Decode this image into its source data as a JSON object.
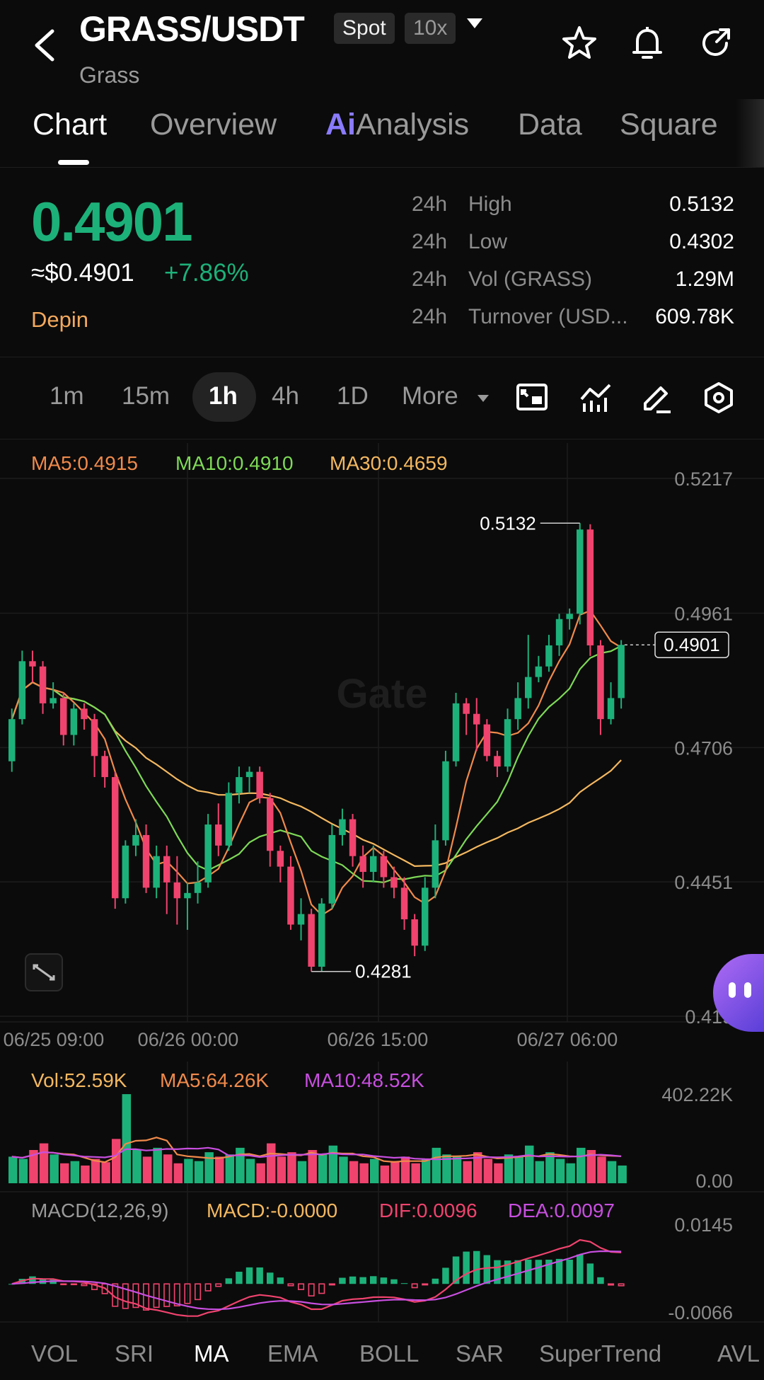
{
  "header": {
    "pair": "GRASS/USDT",
    "market_type": "Spot",
    "leverage": "10x",
    "subtitle": "Grass"
  },
  "tabs": [
    {
      "label": "Chart",
      "active": true
    },
    {
      "label": "Overview"
    },
    {
      "ai_prefix": "Ai",
      "label": "Analysis"
    },
    {
      "label": "Data"
    },
    {
      "label": "Square"
    }
  ],
  "ticker": {
    "price": "0.4901",
    "usd_price": "≈$0.4901",
    "change": "+7.86%",
    "tag": "Depin",
    "stats": [
      {
        "period": "24h",
        "label": "High",
        "value": "0.5132"
      },
      {
        "period": "24h",
        "label": "Low",
        "value": "0.4302"
      },
      {
        "period": "24h",
        "label": "Vol (GRASS)",
        "value": "1.29M"
      },
      {
        "period": "24h",
        "label": "Turnover (USD...",
        "value": "609.78K"
      }
    ]
  },
  "timeframes": [
    "1m",
    "15m",
    "1h",
    "4h",
    "1D",
    "More"
  ],
  "active_timeframe": "1h",
  "chart_data": {
    "type": "candlestick",
    "ma_legend": [
      {
        "text": "MA5:0.4915",
        "color": "#f08a4b"
      },
      {
        "text": "MA10:0.4910",
        "color": "#7ed957"
      },
      {
        "text": "MA30:0.4659",
        "color": "#f4b860"
      }
    ],
    "y_ticks": [
      "0.5217",
      "0.4961",
      "0.4706",
      "0.4451",
      "0.419"
    ],
    "y_tick_values": [
      0.5217,
      0.4961,
      0.4706,
      0.4451,
      0.4196
    ],
    "x_ticks": [
      "06/25 09:00",
      "06/26 00:00",
      "06/26 15:00",
      "06/27 06:00"
    ],
    "high_label": "0.5132",
    "low_label": "0.4281",
    "last_price_label": "0.4901",
    "watermark": "Gate",
    "candles": [
      [
        0.468,
        0.476,
        0.466,
        0.478
      ],
      [
        0.476,
        0.487,
        0.475,
        0.489
      ],
      [
        0.487,
        0.486,
        0.483,
        0.489
      ],
      [
        0.486,
        0.479,
        0.477,
        0.487
      ],
      [
        0.479,
        0.48,
        0.478,
        0.483
      ],
      [
        0.48,
        0.473,
        0.471,
        0.481
      ],
      [
        0.473,
        0.478,
        0.471,
        0.479
      ],
      [
        0.478,
        0.476,
        0.474,
        0.479
      ],
      [
        0.476,
        0.469,
        0.465,
        0.477
      ],
      [
        0.469,
        0.465,
        0.463,
        0.47
      ],
      [
        0.465,
        0.442,
        0.44,
        0.466
      ],
      [
        0.442,
        0.452,
        0.441,
        0.453
      ],
      [
        0.452,
        0.454,
        0.45,
        0.457
      ],
      [
        0.454,
        0.444,
        0.443,
        0.456
      ],
      [
        0.444,
        0.45,
        0.442,
        0.452
      ],
      [
        0.45,
        0.445,
        0.439,
        0.452
      ],
      [
        0.445,
        0.442,
        0.437,
        0.45
      ],
      [
        0.442,
        0.443,
        0.436,
        0.445
      ],
      [
        0.443,
        0.445,
        0.441,
        0.449
      ],
      [
        0.445,
        0.456,
        0.444,
        0.458
      ],
      [
        0.456,
        0.452,
        0.45,
        0.46
      ],
      [
        0.452,
        0.462,
        0.451,
        0.464
      ],
      [
        0.462,
        0.465,
        0.46,
        0.467
      ],
      [
        0.465,
        0.466,
        0.462,
        0.467
      ],
      [
        0.466,
        0.461,
        0.46,
        0.467
      ],
      [
        0.461,
        0.451,
        0.448,
        0.462
      ],
      [
        0.451,
        0.448,
        0.445,
        0.452
      ],
      [
        0.448,
        0.437,
        0.436,
        0.45
      ],
      [
        0.437,
        0.439,
        0.434,
        0.442
      ],
      [
        0.439,
        0.429,
        0.4281,
        0.44
      ],
      [
        0.429,
        0.441,
        0.4281,
        0.442
      ],
      [
        0.441,
        0.454,
        0.44,
        0.456
      ],
      [
        0.454,
        0.457,
        0.452,
        0.459
      ],
      [
        0.457,
        0.45,
        0.448,
        0.458
      ],
      [
        0.45,
        0.447,
        0.444,
        0.452
      ],
      [
        0.447,
        0.45,
        0.445,
        0.452
      ],
      [
        0.45,
        0.446,
        0.444,
        0.451
      ],
      [
        0.446,
        0.444,
        0.442,
        0.448
      ],
      [
        0.444,
        0.438,
        0.436,
        0.446
      ],
      [
        0.438,
        0.433,
        0.431,
        0.439
      ],
      [
        0.433,
        0.444,
        0.432,
        0.446
      ],
      [
        0.444,
        0.453,
        0.442,
        0.456
      ],
      [
        0.453,
        0.468,
        0.452,
        0.47
      ],
      [
        0.468,
        0.479,
        0.467,
        0.481
      ],
      [
        0.479,
        0.477,
        0.473,
        0.48
      ],
      [
        0.477,
        0.475,
        0.47,
        0.48
      ],
      [
        0.475,
        0.469,
        0.468,
        0.476
      ],
      [
        0.469,
        0.467,
        0.465,
        0.47
      ],
      [
        0.467,
        0.476,
        0.466,
        0.478
      ],
      [
        0.476,
        0.48,
        0.474,
        0.483
      ],
      [
        0.48,
        0.484,
        0.478,
        0.492
      ],
      [
        0.484,
        0.486,
        0.483,
        0.488
      ],
      [
        0.486,
        0.49,
        0.485,
        0.492
      ],
      [
        0.49,
        0.495,
        0.488,
        0.496
      ],
      [
        0.495,
        0.496,
        0.493,
        0.497
      ],
      [
        0.496,
        0.512,
        0.494,
        0.5132
      ],
      [
        0.512,
        0.49,
        0.488,
        0.513
      ],
      [
        0.49,
        0.476,
        0.473,
        0.491
      ],
      [
        0.476,
        0.48,
        0.475,
        0.483
      ],
      [
        0.48,
        0.4901,
        0.478,
        0.491
      ]
    ],
    "volume_legend": [
      {
        "text": "Vol:52.59K",
        "color": "#f4b860"
      },
      {
        "text": "MA5:64.26K",
        "color": "#f08a4b"
      },
      {
        "text": "MA10:48.52K",
        "color": "#c84fe0"
      }
    ],
    "volume_ticks": [
      "402.22K",
      "0.00"
    ],
    "volume_ylim": [
      0,
      402.22
    ],
    "volumes_k": [
      120,
      110,
      150,
      180,
      130,
      90,
      100,
      80,
      110,
      95,
      200,
      402,
      150,
      120,
      160,
      130,
      90,
      110,
      100,
      140,
      120,
      130,
      160,
      110,
      90,
      180,
      120,
      140,
      100,
      150,
      130,
      170,
      120,
      100,
      90,
      110,
      80,
      100,
      120,
      90,
      110,
      160,
      130,
      120,
      100,
      140,
      110,
      90,
      130,
      120,
      170,
      100,
      140,
      110,
      90,
      160,
      150,
      120,
      100,
      80
    ],
    "macd_legend": [
      {
        "text": "MACD(12,26,9)",
        "color": "#9a9a9a"
      },
      {
        "text": "MACD:-0.0000",
        "color": "#f4b860"
      },
      {
        "text": "DIF:0.0096",
        "color": "#f0436e"
      },
      {
        "text": "DEA:0.0097",
        "color": "#c84fe0"
      }
    ],
    "macd_ticks": [
      "0.0145",
      "-0.0066"
    ],
    "macd_ylim": [
      -0.0066,
      0.0145
    ]
  },
  "indicator_tabs": [
    "VOL",
    "SRI",
    "MA",
    "EMA",
    "BOLL",
    "SAR",
    "SuperTrend",
    "AVL"
  ],
  "active_indicator": "MA"
}
